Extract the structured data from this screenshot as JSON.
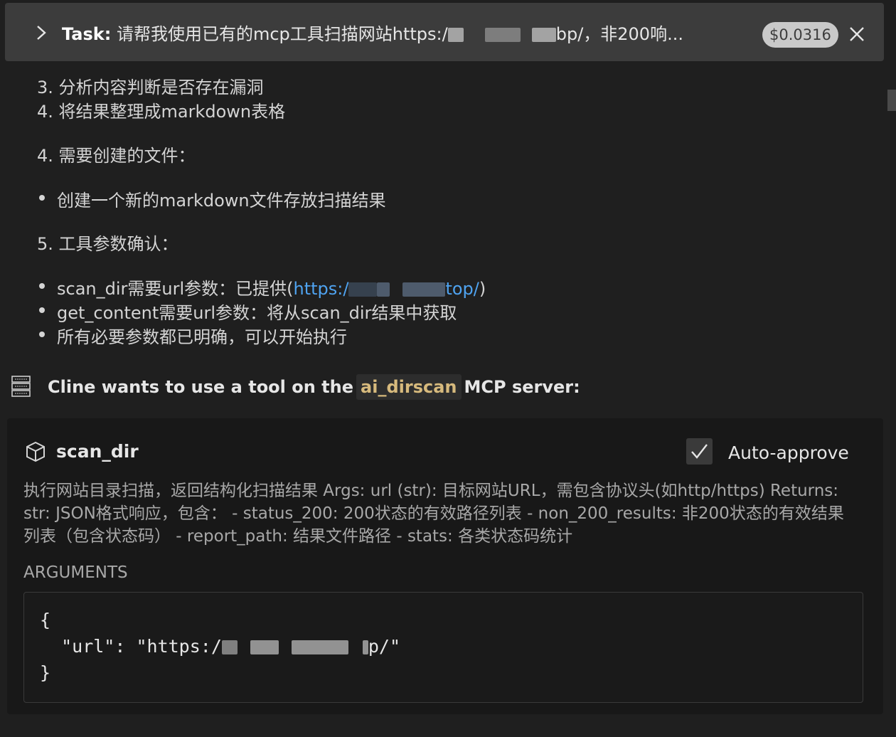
{
  "task": {
    "label": "Task:",
    "text_before": "请帮我使用已有的mcp工具扫描网站https:/",
    "text_after": "bp/，非200响...",
    "cost": "$0.0316"
  },
  "content": {
    "line1": "3. 分析内容判断是否存在漏洞",
    "line2": "4. 将结果整理成markdown表格",
    "line3": "4. 需要创建的文件：",
    "bullet1": "创建一个新的markdown文件存放扫描结果",
    "line4": "5. 工具参数确认：",
    "bullet2_prefix": "scan_dir需要url参数：已提供(",
    "bullet2_link_start": "https:/",
    "bullet2_link_end": "top/",
    "bullet2_suffix": ")",
    "bullet3": "get_content需要url参数：将从scan_dir结果中获取",
    "bullet4": "所有必要参数都已明确，可以开始执行"
  },
  "mcp": {
    "prefix": "Cline wants to use a tool on the",
    "server": "ai_dirscan",
    "suffix": "MCP server:"
  },
  "tool": {
    "name": "scan_dir",
    "auto_approve": "Auto-approve",
    "description": "执行网站目录扫描，返回结构化扫描结果 Args: url (str): 目标网站URL，需包含协议头(如http/https) Returns: str: JSON格式响应，包含：  - status_200: 200状态的有效路径列表 - non_200_results: 非200状态的有效结果列表（包含状态码） - report_path: 结果文件路径 - stats: 各类状态码统计",
    "args_title": "ARGUMENTS",
    "code_open": "{",
    "code_key": "  \"url\": \"https:/",
    "code_tail": "p/\"",
    "code_close": "}"
  }
}
